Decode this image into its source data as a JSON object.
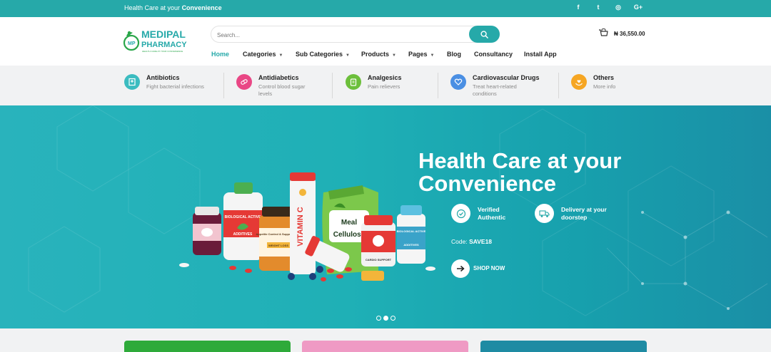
{
  "topbar": {
    "tagline_prefix": "Health Care at your",
    "tagline_bold": "Convenience",
    "social": [
      {
        "icon": "facebook-icon",
        "glyph": "f"
      },
      {
        "icon": "twitter-icon",
        "glyph": "t"
      },
      {
        "icon": "instagram-icon",
        "glyph": "◎"
      },
      {
        "icon": "google-plus-icon",
        "glyph": "G+"
      }
    ]
  },
  "header": {
    "logo": {
      "line1": "MEDIPAL",
      "line2": "PHARMACY",
      "badge": "MP",
      "subtext": "HEALTH CARE AT YOUR CONVENIENCE"
    },
    "search": {
      "placeholder": "Search..."
    },
    "cart_total": "₦ 36,550.00"
  },
  "nav": [
    {
      "label": "Home",
      "active": true,
      "dropdown": false
    },
    {
      "label": "Categories",
      "active": false,
      "dropdown": true
    },
    {
      "label": "Sub Categories",
      "active": false,
      "dropdown": true
    },
    {
      "label": "Products",
      "active": false,
      "dropdown": true
    },
    {
      "label": "Pages",
      "active": false,
      "dropdown": true
    },
    {
      "label": "Blog",
      "active": false,
      "dropdown": false
    },
    {
      "label": "Consultancy",
      "active": false,
      "dropdown": false
    },
    {
      "label": "Install App",
      "active": false,
      "dropdown": false
    }
  ],
  "categories": [
    {
      "title": "Antibiotics",
      "subtitle": "Fight bacterial infections",
      "color": "#3bbcc0",
      "icon": "hospital-icon"
    },
    {
      "title": "Antidiabetics",
      "subtitle": "Control blood sugar levels",
      "color": "#e94785",
      "icon": "pills-icon"
    },
    {
      "title": "Analgesics",
      "subtitle": "Pain relievers",
      "color": "#6cbf3b",
      "icon": "clipboard-icon"
    },
    {
      "title": "Cardiovascular Drugs",
      "subtitle": "Treat heart-related conditions",
      "color": "#4a8fe3",
      "icon": "heart-icon"
    },
    {
      "title": "Others",
      "subtitle": "More info",
      "color": "#f6a623",
      "icon": "hands-icon"
    }
  ],
  "hero": {
    "title": "Health Care at your Convenience",
    "features": [
      {
        "label": "Verified Authentic",
        "icon": "verified-badge-icon"
      },
      {
        "label": "Delivery at your doorstep",
        "icon": "delivery-truck-icon"
      }
    ],
    "code_label": "Code:",
    "code_value": "SAVE18",
    "cta": "SHOP NOW",
    "slide_count": 3,
    "active_slide": 1,
    "product_labels": {
      "bottle1": "BIOLOGICAL ACTIVE",
      "bottle1_sub": "ADDITIVES",
      "tube": "VITAMIN C",
      "bag1": "Meal",
      "bag2": "Cellulose",
      "jar": "Appetite Control & Suppressants",
      "jar_sub": "WEIGHT LOSS",
      "cardio": "CARDIO SUPPORT",
      "bottle2": "BIOLOGICAL ACTIVE",
      "bottle2_sub": "ADDITIVES"
    }
  },
  "bottom_cards": [
    {
      "color": "#2eaa3a"
    },
    {
      "color": "#ef9ac4"
    },
    {
      "color": "#1e8ba3"
    }
  ]
}
